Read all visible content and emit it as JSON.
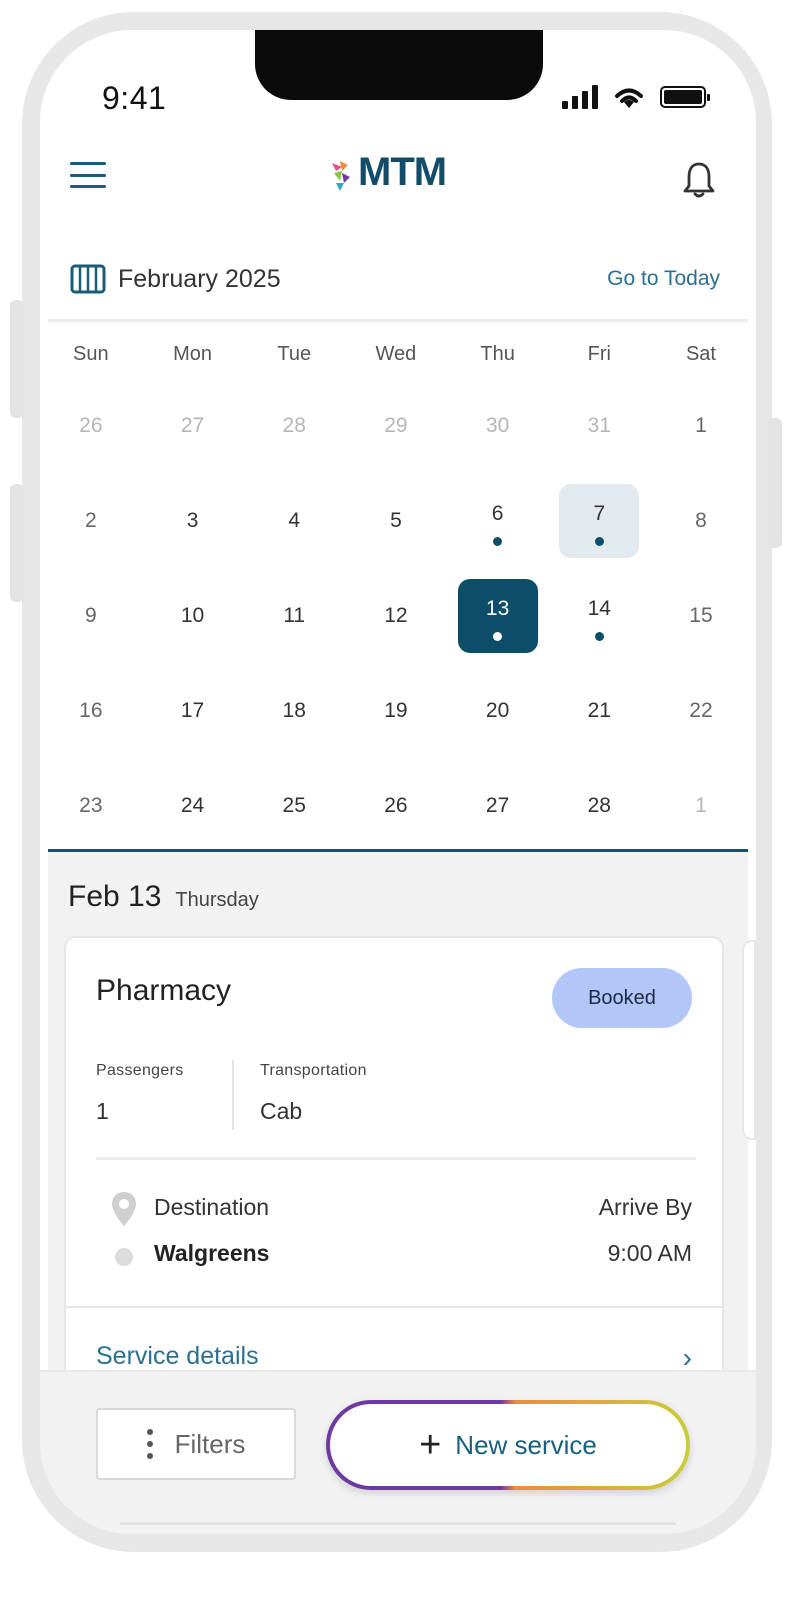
{
  "status_bar": {
    "time": "9:41"
  },
  "header": {
    "logo_text": "MTM"
  },
  "calendar": {
    "month_label": "February 2025",
    "go_to_today": "Go to Today",
    "weekdays": [
      "Sun",
      "Mon",
      "Tue",
      "Wed",
      "Thu",
      "Fri",
      "Sat"
    ],
    "weeks": [
      [
        {
          "d": "26",
          "muted": true
        },
        {
          "d": "27",
          "muted": true
        },
        {
          "d": "28",
          "muted": true
        },
        {
          "d": "29",
          "muted": true
        },
        {
          "d": "30",
          "muted": true
        },
        {
          "d": "31",
          "muted": true
        },
        {
          "d": "1"
        }
      ],
      [
        {
          "d": "2"
        },
        {
          "d": "3"
        },
        {
          "d": "4"
        },
        {
          "d": "5"
        },
        {
          "d": "6",
          "dot": true
        },
        {
          "d": "7",
          "dot": true,
          "highlight": true
        },
        {
          "d": "8"
        }
      ],
      [
        {
          "d": "9"
        },
        {
          "d": "10"
        },
        {
          "d": "11"
        },
        {
          "d": "12"
        },
        {
          "d": "13",
          "dot": true,
          "selected": true
        },
        {
          "d": "14",
          "dot": true
        },
        {
          "d": "15"
        }
      ],
      [
        {
          "d": "16"
        },
        {
          "d": "17"
        },
        {
          "d": "18"
        },
        {
          "d": "19"
        },
        {
          "d": "20"
        },
        {
          "d": "21"
        },
        {
          "d": "22"
        }
      ],
      [
        {
          "d": "23"
        },
        {
          "d": "24"
        },
        {
          "d": "25"
        },
        {
          "d": "26"
        },
        {
          "d": "27"
        },
        {
          "d": "28"
        },
        {
          "d": "1",
          "muted": true
        }
      ]
    ]
  },
  "day_view": {
    "date": "Feb 13",
    "weekday": "Thursday",
    "trip": {
      "title": "Pharmacy",
      "status": "Booked",
      "passengers_label": "Passengers",
      "passengers_value": "1",
      "transportation_label": "Transportation",
      "transportation_value": "Cab",
      "destination_label": "Destination",
      "destination_value": "Walgreens",
      "arrive_label": "Arrive By",
      "arrive_value": "9:00 AM",
      "details_link": "Service details"
    }
  },
  "bottom_bar": {
    "filters_label": "Filters",
    "new_service_label": "New service"
  },
  "colors": {
    "primary": "#0c4e69",
    "link": "#2c6f8f",
    "badge": "#b3c6f8"
  }
}
